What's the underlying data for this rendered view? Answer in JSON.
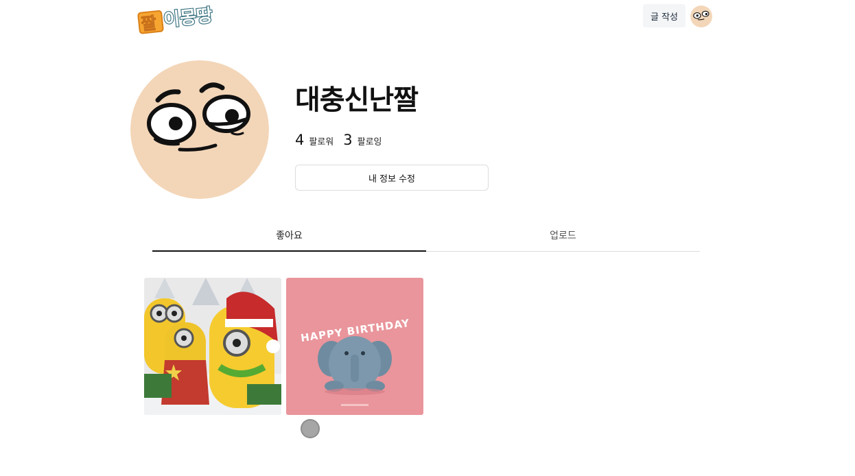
{
  "header": {
    "logo_text": "짤이몽땅",
    "write_button": "글 작성",
    "avatar_icon": "cartoon-face-icon"
  },
  "profile": {
    "username": "대충신난짤",
    "followers_count": "4",
    "followers_label": "팔로워",
    "following_count": "3",
    "following_label": "팔로잉",
    "edit_button": "내 정보 수정"
  },
  "tabs": [
    {
      "label": "좋아요",
      "active": true
    },
    {
      "label": "업로드",
      "active": false
    }
  ],
  "posts": [
    {
      "name": "minions-christmas-gif"
    },
    {
      "name": "happy-birthday-elephant-gif",
      "text": "HAPPY BIRTHDAY"
    }
  ],
  "colors": {
    "logo_orange": "#f7a531",
    "logo_teal": "#2f6b7a",
    "face_skin": "#f3d6b8",
    "birthday_bg": "#e9959b",
    "elephant": "#6e8ba0"
  }
}
